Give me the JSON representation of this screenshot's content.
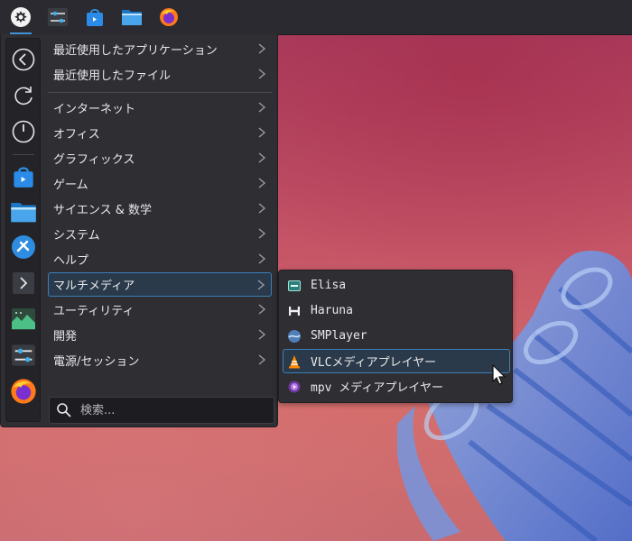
{
  "panel": {
    "buttons": [
      {
        "name": "app-launcher",
        "icon": "app-launcher-icon"
      },
      {
        "name": "system-settings",
        "icon": "settings-sliders-icon"
      },
      {
        "name": "discover",
        "icon": "store-bag-icon"
      },
      {
        "name": "dolphin",
        "icon": "folder-icon"
      },
      {
        "name": "firefox",
        "icon": "firefox-icon"
      }
    ]
  },
  "favorites": [
    {
      "icon": "back-arrow-icon"
    },
    {
      "icon": "refresh-icon"
    },
    {
      "icon": "power-icon"
    },
    {
      "icon": "store-bag-icon"
    },
    {
      "icon": "folder-icon"
    },
    {
      "icon": "kde-connect-icon"
    },
    {
      "icon": "terminal-icon"
    },
    {
      "icon": "system-monitor-icon"
    },
    {
      "icon": "settings-sliders-icon"
    },
    {
      "icon": "firefox-icon"
    }
  ],
  "categories": [
    {
      "label": "最近使用したアプリケーション"
    },
    {
      "label": "最近使用したファイル"
    },
    {
      "label": "インターネット"
    },
    {
      "label": "オフィス"
    },
    {
      "label": "グラフィックス"
    },
    {
      "label": "ゲーム"
    },
    {
      "label": "サイエンス & 数学"
    },
    {
      "label": "システム"
    },
    {
      "label": "ヘルプ"
    },
    {
      "label": "マルチメディア"
    },
    {
      "label": "ユーティリティ"
    },
    {
      "label": "開発"
    },
    {
      "label": "電源/セッション"
    }
  ],
  "selected_category": "マルチメディア",
  "search": {
    "placeholder": "検索..."
  },
  "submenu": {
    "items": [
      {
        "label": "Elisa",
        "icon": "elisa-icon"
      },
      {
        "label": "Haruna",
        "icon": "haruna-icon"
      },
      {
        "label": "SMPlayer",
        "icon": "smplayer-icon"
      },
      {
        "label": "VLCメディアプレイヤー",
        "icon": "vlc-cone-icon"
      },
      {
        "label": "mpv メディアプレイヤー",
        "icon": "mpv-icon"
      }
    ],
    "selected": "VLCメディアプレイヤー"
  },
  "colors": {
    "accent": "#3d93d6",
    "menu_bg": "#2f2e33",
    "panel_bg": "#2b2a30",
    "selection_border": "#3b7fb8"
  }
}
